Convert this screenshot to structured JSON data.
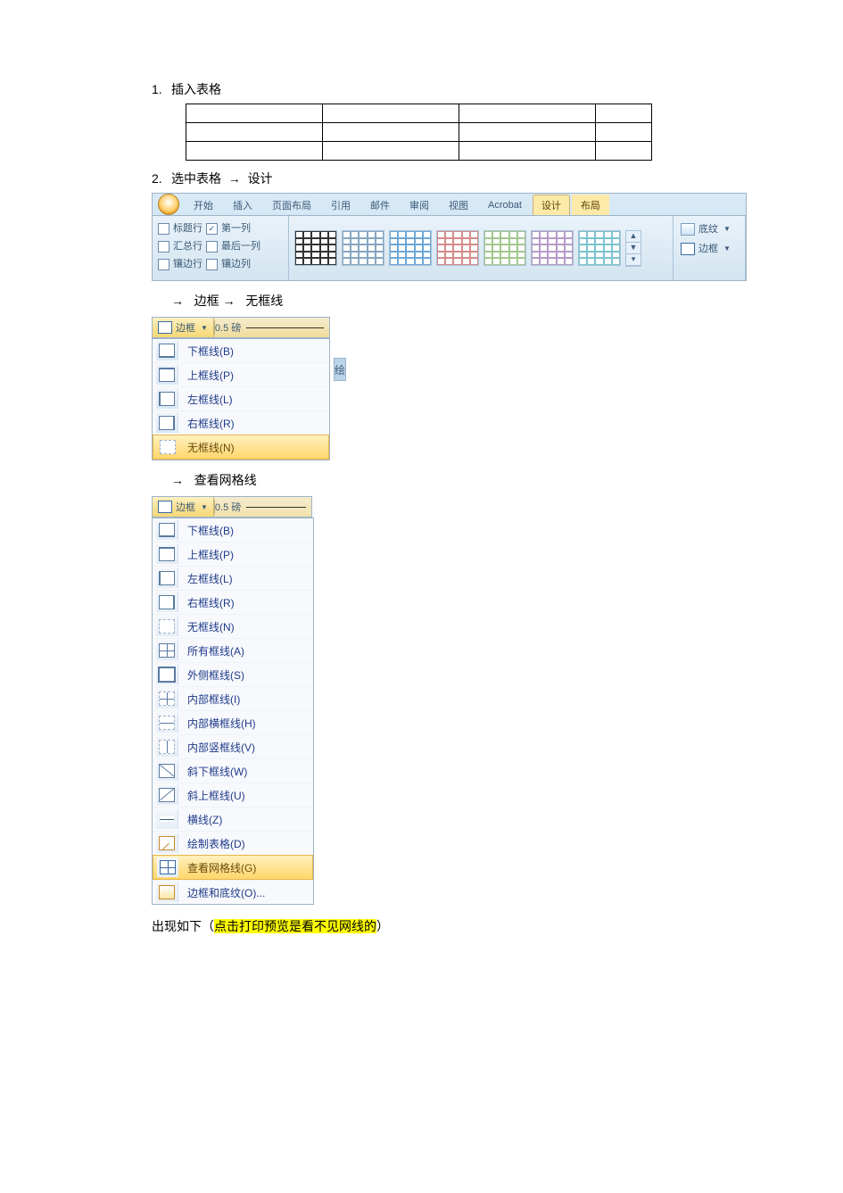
{
  "steps": {
    "s1_num": "1.",
    "s1_text": "插入表格",
    "s2_num": "2.",
    "s2_text_a": "选中表格",
    "arrow": "→",
    "s2_text_b": "设计"
  },
  "ribbon": {
    "tabs": {
      "start": "开始",
      "insert": "插入",
      "layout": "页面布局",
      "ref": "引用",
      "mail": "邮件",
      "review": "审阅",
      "view": "视图",
      "acrobat": "Acrobat",
      "design": "设计",
      "tlayout": "布局"
    },
    "opts": {
      "header_row": "标题行",
      "first_col": "第一列",
      "total_row": "汇总行",
      "last_col": "最后一列",
      "banded_row": "镶边行",
      "banded_col": "镶边列"
    },
    "shade": "底纹",
    "border": "边框"
  },
  "arrow2": {
    "a": "边框",
    "b": "无框线"
  },
  "dd1": {
    "btn": "边框",
    "weight": "0.5 磅",
    "items": {
      "bottom": "下框线(B)",
      "top": "上框线(P)",
      "left": "左框线(L)",
      "right": "右框线(R)",
      "none": "无框线(N)"
    },
    "side": "绘"
  },
  "arrow3": "查看网格线",
  "dd2": {
    "btn": "边框",
    "weight": "0.5 磅",
    "items": {
      "bottom": "下框线(B)",
      "top": "上框线(P)",
      "left": "左框线(L)",
      "right": "右框线(R)",
      "none": "无框线(N)",
      "all": "所有框线(A)",
      "outer": "外侧框线(S)",
      "inner": "内部框线(I)",
      "innerh": "内部横框线(H)",
      "innerv": "内部竖框线(V)",
      "diagdown": "斜下框线(W)",
      "diagup": "斜上框线(U)",
      "hr": "横线(Z)",
      "draw": "绘制表格(D)",
      "grid": "查看网格线(G)",
      "shade": "边框和底纹(O)..."
    }
  },
  "final": {
    "pre": "出现如下（",
    "hl": "点击打印预览是看不见网线的",
    "post": "）"
  }
}
